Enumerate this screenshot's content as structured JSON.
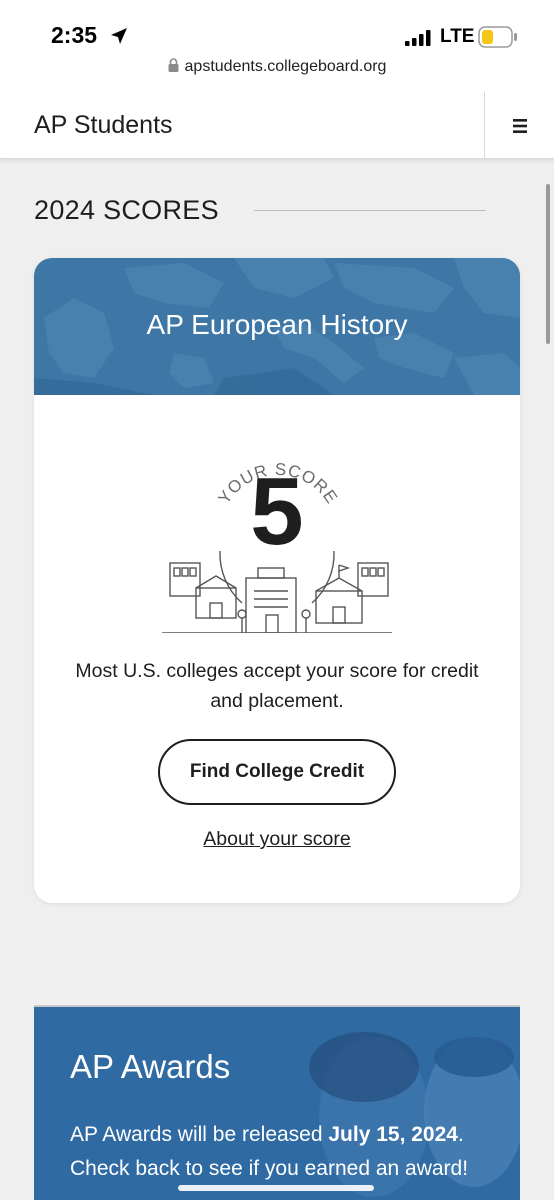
{
  "status_bar": {
    "time": "2:35",
    "network": "LTE",
    "url": "apstudents.collegeboard.org",
    "icons": [
      "location-arrow-icon",
      "signal-icon",
      "battery-icon",
      "lock-icon"
    ]
  },
  "header": {
    "title": "AP Students",
    "menu_icon": "hamburger-menu-icon"
  },
  "scores_section": {
    "title": "2024 SCORES"
  },
  "score_card": {
    "course": "AP European History",
    "your_score_label": "YOUR SCORE",
    "score": "5",
    "message": "Most U.S. colleges accept your score for credit and placement.",
    "button_label": "Find College Credit",
    "link_label": "About your score"
  },
  "awards_card": {
    "title": "AP Awards",
    "text_before": "AP Awards will be released ",
    "release_date": "July 15, 2024",
    "text_after": ". Check back to see if you earned an award!"
  },
  "colors": {
    "banner_blue": "#3e77a6",
    "awards_blue": "#2f6aa3",
    "page_bg": "#efefef",
    "battery_yellow": "#f5c518"
  }
}
